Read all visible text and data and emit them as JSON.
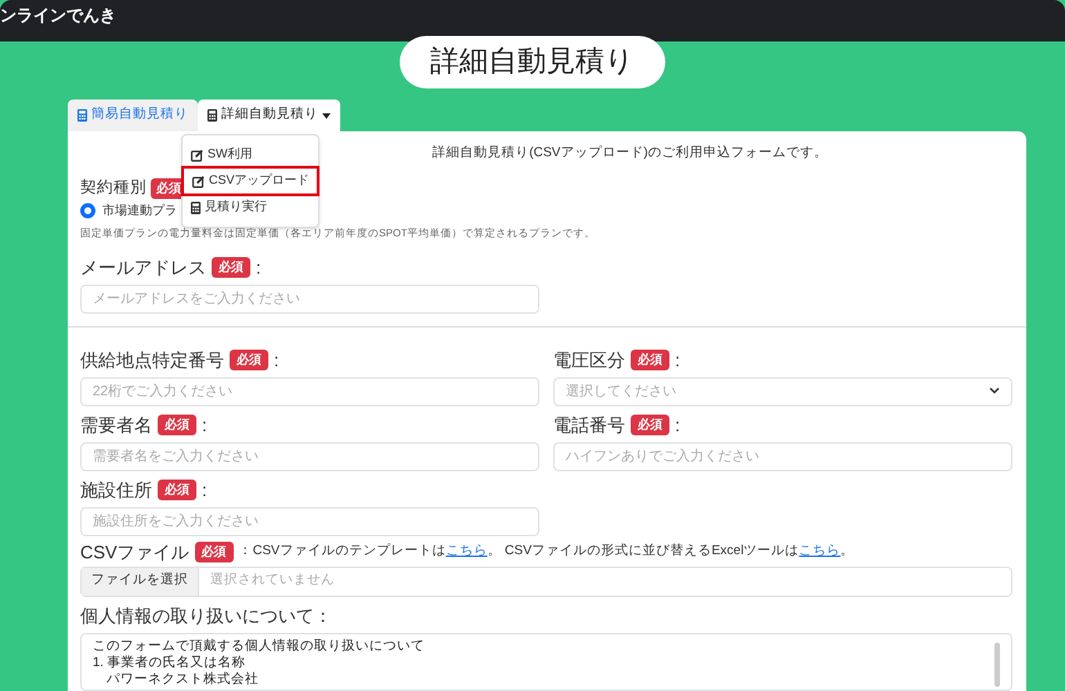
{
  "app_title": "ンラインでんき",
  "page_title": "詳細自動見積り",
  "tabs": [
    {
      "label": "簡易自動見積り",
      "selected": false,
      "kind": "link"
    },
    {
      "label": "詳細自動見積り",
      "selected": true,
      "kind": "dropdown"
    }
  ],
  "dropdown_menu": [
    {
      "label": "SW利用",
      "kind": "edit",
      "highlighted": false
    },
    {
      "label": "CSVアップロード",
      "kind": "edit",
      "highlighted": true
    },
    {
      "label": "見積り実行",
      "kind": "calculator",
      "highlighted": false
    }
  ],
  "intro": "詳細自動見積り(CSVアップロード)のご利用申込フォームです。",
  "contract": {
    "label": "契約種別",
    "badge": "必須",
    "radio": {
      "label": "市場連動プラ",
      "selected": true
    },
    "note": "固定単価プランの電力量料金は固定単価（各エリア前年度のSPOT平均単価）で算定されるプランです。"
  },
  "email": {
    "label": "メールアドレス",
    "badge": "必須",
    "suffix": ":",
    "placeholder": "メールアドレスをご入力ください",
    "kind": "text"
  },
  "rows": [
    [
      {
        "label": "供給地点特定番号",
        "badge": "必須",
        "suffix": ":",
        "placeholder": "22桁でご入力ください",
        "kind": "text"
      },
      {
        "label": "電圧区分",
        "badge": "必須",
        "suffix": ":",
        "placeholder": "選択してください",
        "kind": "select"
      }
    ],
    [
      {
        "label": "需要者名",
        "badge": "必須",
        "suffix": ":",
        "placeholder": "需要者名をご入力ください",
        "kind": "text"
      },
      {
        "label": "電話番号",
        "badge": "必須",
        "suffix": ":",
        "placeholder": "ハイフンありでご入力ください",
        "kind": "text"
      }
    ],
    [
      {
        "label": "施設住所",
        "badge": "必須",
        "suffix": ":",
        "placeholder": "施設住所をご入力ください",
        "kind": "text"
      }
    ]
  ],
  "csv": {
    "label": "CSVファイル",
    "badge": "必須",
    "description": [
      {
        "kind": "text",
        "text": "：CSVファイルのテンプレートは"
      },
      {
        "kind": "link",
        "text": "こちら"
      },
      {
        "kind": "text",
        "text": "。 CSVファイルの形式に並び替えるExcelツールは"
      },
      {
        "kind": "link",
        "text": "こちら"
      },
      {
        "kind": "text",
        "text": "。"
      }
    ],
    "file_button": "ファイルを選択",
    "file_status": "選択されていません"
  },
  "privacy": {
    "label": "個人情報の取り扱いについて：",
    "lines": [
      "このフォームで頂戴する個人情報の取り扱いについて",
      "1. 事業者の氏名又は名称",
      "　パワーネクスト株式会社"
    ]
  }
}
